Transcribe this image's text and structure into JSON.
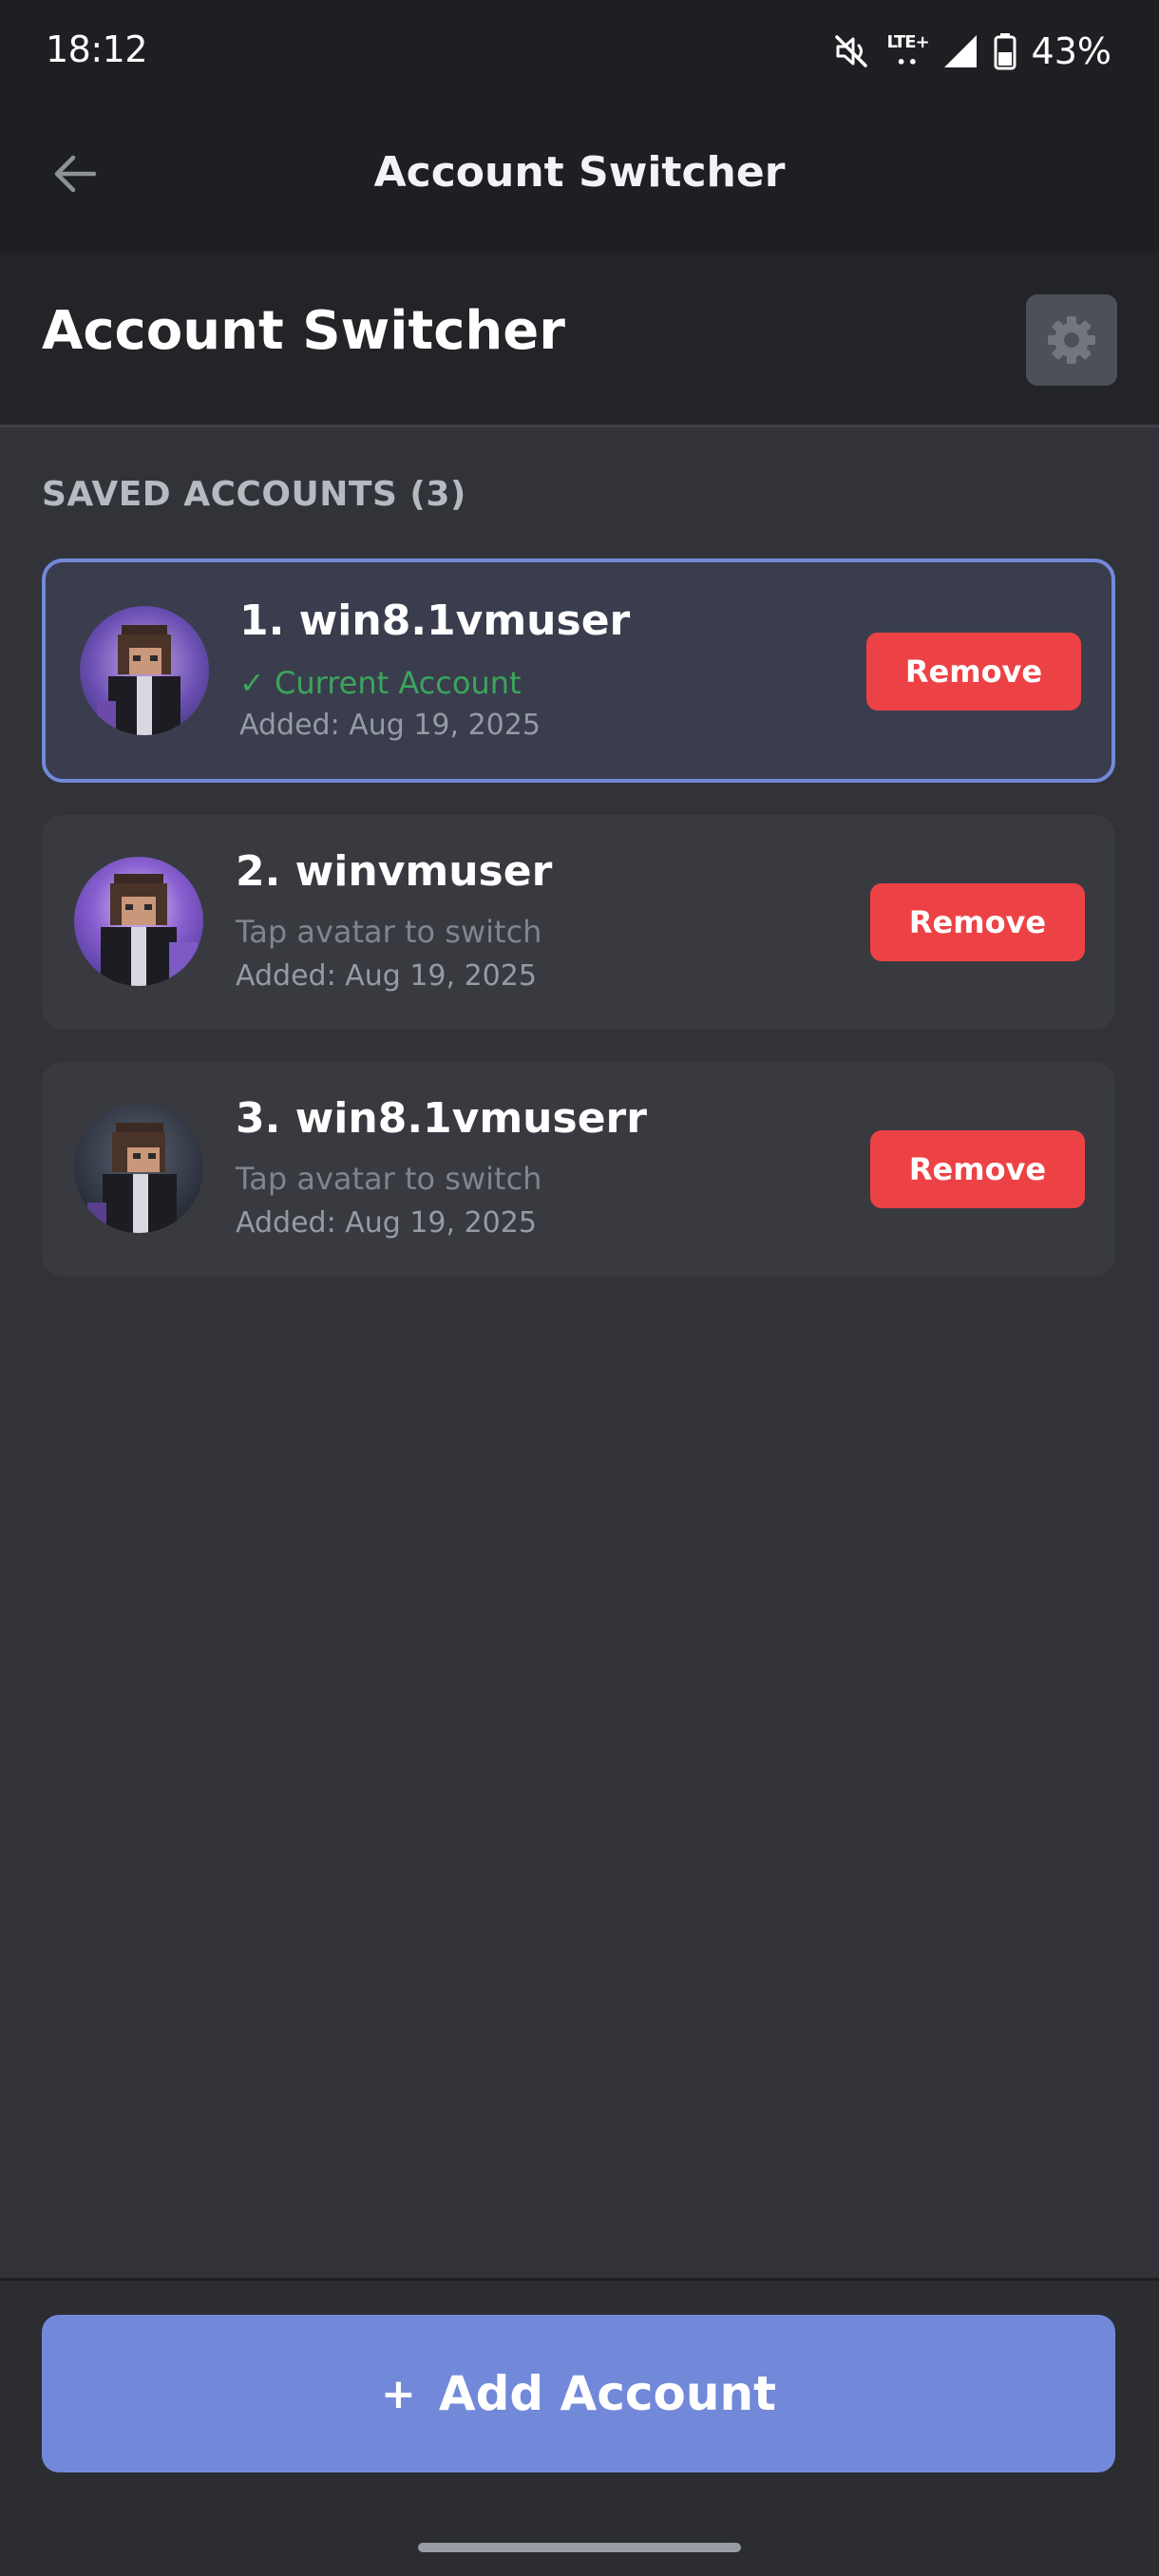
{
  "status_bar": {
    "time": "18:12",
    "network_label": "LTE+",
    "network_sub": "••",
    "battery": "43%",
    "icons": [
      "mute-vibrate-icon",
      "lte-icon",
      "signal-icon",
      "battery-icon"
    ]
  },
  "app_bar": {
    "title": "Account Switcher",
    "back_icon": "arrow-left-icon"
  },
  "header": {
    "title": "Account Switcher",
    "settings_icon": "gear-icon"
  },
  "section": {
    "label": "SAVED ACCOUNTS (3)"
  },
  "accounts": [
    {
      "name": "1. win8.1vmuser",
      "status": "✓ Current Account",
      "added": "Added: Aug 19, 2025",
      "remove_label": "Remove",
      "current": true
    },
    {
      "name": "2. winvmuser",
      "status": "Tap avatar to switch",
      "added": "Added: Aug 19, 2025",
      "remove_label": "Remove",
      "current": false
    },
    {
      "name": "3. win8.1vmuserr",
      "status": "Tap avatar to switch",
      "added": "Added: Aug 19, 2025",
      "remove_label": "Remove",
      "current": false
    }
  ],
  "add_account": {
    "plus": "+",
    "label": "Add Account"
  },
  "colors": {
    "background": "#313338",
    "bars": "#1e1f22",
    "accent": "#7289da",
    "danger": "#ed4245",
    "success": "#3ba55c"
  }
}
